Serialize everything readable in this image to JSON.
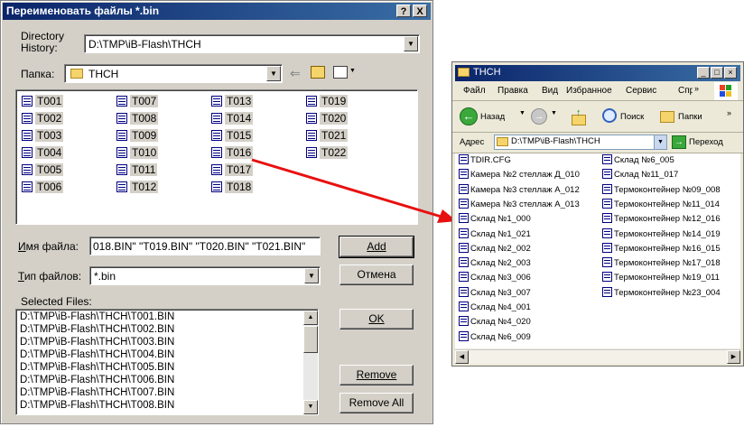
{
  "dialog": {
    "title": "Переименовать файлы *.bin",
    "help_label": "?",
    "close_label": "X",
    "directory_history_label": "Directory\nHistory:",
    "directory_history_value": "D:\\TMP\\iB-Flash\\THCH",
    "folder_label": "Папка:",
    "folder_value": "THCH",
    "file_list": [
      "T001",
      "T002",
      "T003",
      "T004",
      "T005",
      "T006",
      "T007",
      "T008",
      "T009",
      "T010",
      "T011",
      "T012",
      "T013",
      "T014",
      "T015",
      "T016",
      "T017",
      "T018",
      "T019",
      "T020",
      "T021",
      "T022"
    ],
    "filename_label": "Имя файла:",
    "filename_value": "018.BIN\" \"T019.BIN\" \"T020.BIN\" \"T021.BIN\"",
    "filetype_label": "Тип файлов:",
    "filetype_value": "*.bin",
    "add_label": "Add",
    "cancel_label": "Отмена",
    "ok_label": "OK",
    "remove_label": "Remove",
    "remove_all_label": "Remove All",
    "selected_files_label": "Selected Files:",
    "selected_files": [
      "D:\\TMP\\iB-Flash\\THCH\\T001.BIN",
      "D:\\TMP\\iB-Flash\\THCH\\T002.BIN",
      "D:\\TMP\\iB-Flash\\THCH\\T003.BIN",
      "D:\\TMP\\iB-Flash\\THCH\\T004.BIN",
      "D:\\TMP\\iB-Flash\\THCH\\T005.BIN",
      "D:\\TMP\\iB-Flash\\THCH\\T006.BIN",
      "D:\\TMP\\iB-Flash\\THCH\\T007.BIN",
      "D:\\TMP\\iB-Flash\\THCH\\T008.BIN"
    ]
  },
  "explorer": {
    "title": "THCH",
    "menu": [
      "Файл",
      "Правка",
      "Вид",
      "Избранное",
      "Сервис",
      "Справка"
    ],
    "back_label": "Назад",
    "search_label": "Поиск",
    "folders_label": "Папки",
    "address_label": "Адрес",
    "address_value": "D:\\TMP\\iB-Flash\\THCH",
    "go_label": "Переход",
    "files_col1": [
      "TDIR.CFG",
      "Камера №2 стеллаж Д_010",
      "Камера №3 стеллаж А_012",
      "Камера №3 стеллаж А_013",
      "Склад №1_000",
      "Склад №1_021",
      "Склад №2_002",
      "Склад №2_003",
      "Склад №3_006",
      "Склад №3_007",
      "Склад №4_001",
      "Склад №4_020",
      "Склад №6_009"
    ],
    "files_col2": [
      "Склад №6_005",
      "Склад №11_017",
      "Термоконтейнер №09_008",
      "Термоконтейнер №11_014",
      "Термоконтейнер №12_016",
      "Термоконтейнер №14_019",
      "Термоконтейнер №16_015",
      "Термоконтейнер №17_018",
      "Термоконтейнер №19_011",
      "Термоконтейнер №23_004"
    ]
  },
  "colors": {
    "title_bar": "#0a246a",
    "dialog_bg": "#d4d0c8",
    "arrow": "#e81010"
  }
}
